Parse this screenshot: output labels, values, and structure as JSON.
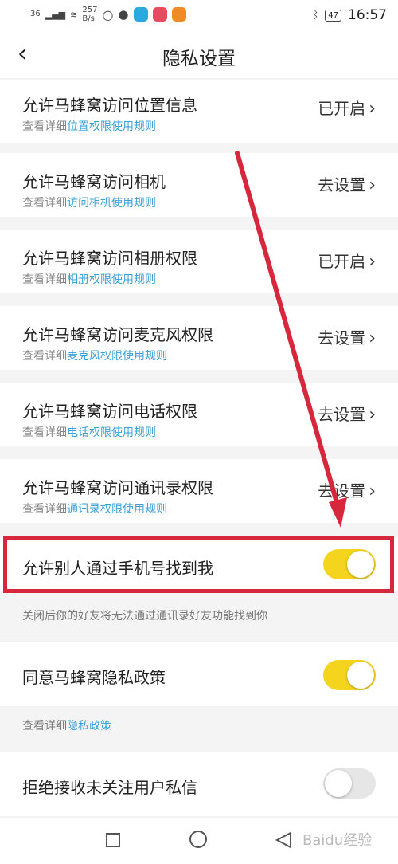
{
  "status_bar": {
    "signal": "36",
    "net_speed_value": "257",
    "net_speed_unit": "B/s",
    "battery": "47",
    "time": "16:57"
  },
  "header": {
    "title": "隐私设置"
  },
  "permissions": [
    {
      "title": "允许马蜂窝访问位置信息",
      "sub_prefix": "查看详细",
      "sub_link": "位置权限使用规则",
      "status": "已开启"
    },
    {
      "title": "允许马蜂窝访问相机",
      "sub_prefix": "查看详细",
      "sub_link": "访问相机使用规则",
      "status": "去设置"
    },
    {
      "title": "允许马蜂窝访问相册权限",
      "sub_prefix": "查看详细",
      "sub_link": "相册权限使用规则",
      "status": "已开启"
    },
    {
      "title": "允许马蜂窝访问麦克风权限",
      "sub_prefix": "查看详细",
      "sub_link": "麦克风权限使用规则",
      "status": "去设置"
    },
    {
      "title": "允许马蜂窝访问电话权限",
      "sub_prefix": "查看详细",
      "sub_link": "电话权限使用规则",
      "status": "去设置"
    },
    {
      "title": "允许马蜂窝访问通讯录权限",
      "sub_prefix": "查看详细",
      "sub_link": "通讯录权限使用规则",
      "status": "去设置"
    }
  ],
  "toggles": {
    "find_by_phone": {
      "label": "允许别人通过手机号找到我",
      "on": true,
      "note": "关闭后你的好友将无法通过通讯录好友功能找到你"
    },
    "privacy_policy": {
      "label": "同意马蜂窝隐私政策",
      "on": true,
      "note_prefix": "查看详细",
      "note_link": "隐私政策"
    },
    "reject_dm": {
      "label": "拒绝接收未关注用户私信",
      "on": false
    }
  },
  "watermark": "Baidu经验",
  "colors": {
    "toggle_on": "#f5d41e",
    "link": "#3aa0d8",
    "annotation": "#d7273c"
  }
}
